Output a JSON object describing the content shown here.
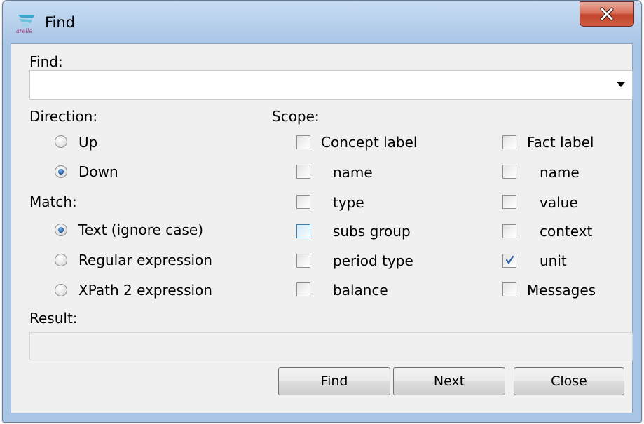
{
  "window": {
    "title": "Find",
    "app_icon": "arelle-logo-icon",
    "close_icon": "close-icon"
  },
  "find": {
    "label": "Find:",
    "value": "",
    "dropdown_icon": "dropdown-arrow-icon"
  },
  "direction": {
    "label": "Direction:",
    "options": [
      {
        "label": "Up",
        "selected": false
      },
      {
        "label": "Down",
        "selected": true
      }
    ]
  },
  "match": {
    "label": "Match:",
    "options": [
      {
        "label": "Text (ignore case)",
        "selected": true
      },
      {
        "label": "Regular expression",
        "selected": false
      },
      {
        "label": "XPath 2 expression",
        "selected": false
      }
    ]
  },
  "scope": {
    "label": "Scope:",
    "concept": [
      {
        "label": "Concept label",
        "checked": false
      },
      {
        "label": "name",
        "checked": false
      },
      {
        "label": "type",
        "checked": false
      },
      {
        "label": "subs group",
        "checked": false
      },
      {
        "label": "period type",
        "checked": false
      },
      {
        "label": "balance",
        "checked": false
      }
    ],
    "fact": [
      {
        "label": "Fact label",
        "checked": false
      },
      {
        "label": "name",
        "checked": false
      },
      {
        "label": "value",
        "checked": false
      },
      {
        "label": "context",
        "checked": false
      },
      {
        "label": "unit",
        "checked": true
      },
      {
        "label": "Messages",
        "checked": false
      }
    ]
  },
  "result": {
    "label": "Result:",
    "value": ""
  },
  "buttons": {
    "find": "Find",
    "next": "Next",
    "close": "Close"
  },
  "colors": {
    "title_bar": "#b9d1ec",
    "close_button": "#c2442c",
    "dialog_background": "#f0f0f0",
    "radio_selected": "#2a63a8"
  }
}
